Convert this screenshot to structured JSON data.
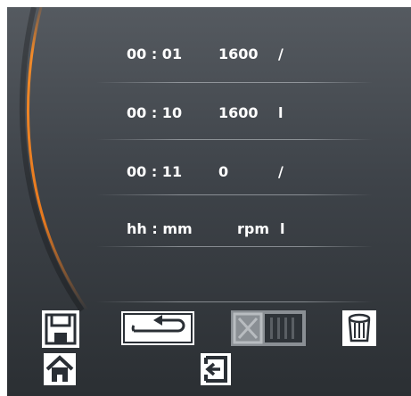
{
  "rows": [
    {
      "time": "00 : 01",
      "rpm": "1600",
      "dir": "/"
    },
    {
      "time": "00 : 10",
      "rpm": "1600",
      "dir": "l"
    },
    {
      "time": "00 : 11",
      "rpm": "0",
      "dir": "/"
    },
    {
      "time": "hh : mm",
      "rpm": "rpm",
      "dir": "l"
    }
  ],
  "icons": {
    "save": "save-icon",
    "back": "return-arrow-icon",
    "cancel": "cancel-disabled-icon",
    "delete": "trash-icon",
    "home": "home-icon",
    "exit": "exit-icon"
  },
  "colors": {
    "accent_arc": "#e8791e",
    "text": "#ffffff",
    "button_bg": "#ffffff",
    "button_icon": "#2a2f35"
  }
}
